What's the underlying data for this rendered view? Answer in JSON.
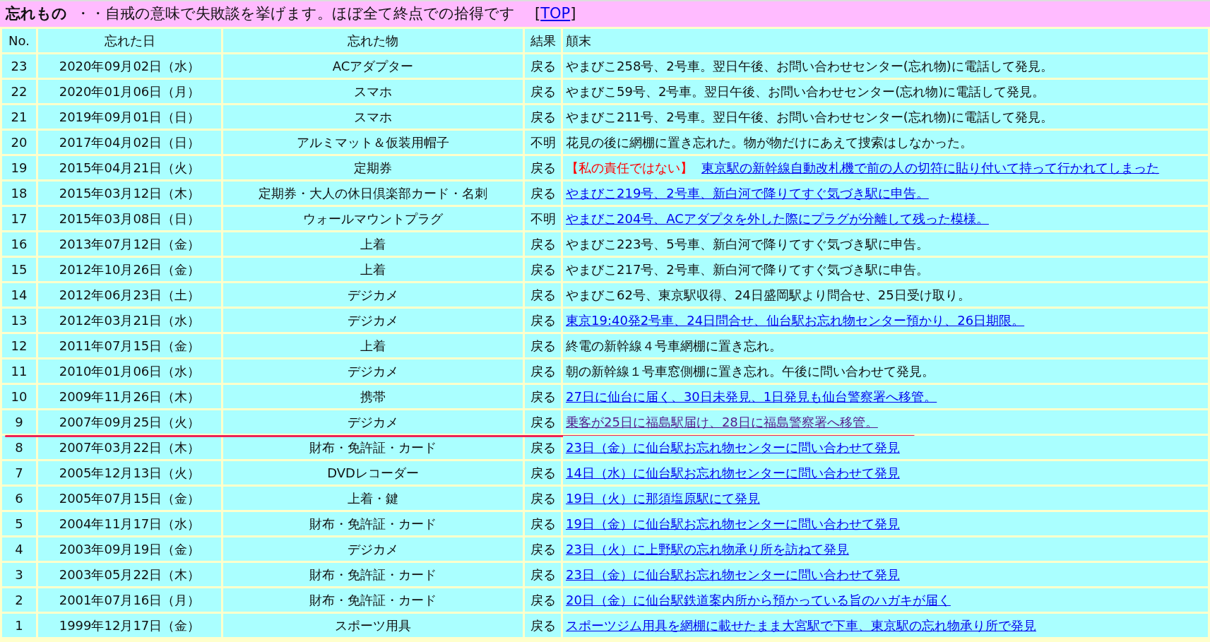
{
  "header": {
    "title": "忘れもの",
    "description": "・・自戒の意味で失敗談を挙げます。ほぼ全て終点での拾得です",
    "top_link": {
      "open": "[",
      "label": "TOP",
      "close": "]"
    }
  },
  "table": {
    "columns": [
      "No.",
      "忘れた日",
      "忘れた物",
      "結果",
      "顛末"
    ],
    "rows": [
      {
        "no": "23",
        "date": "2020年09月02日（水）",
        "item": "ACアダプター",
        "result": "戻る",
        "remarks": [
          {
            "kind": "text",
            "text": "やまびこ258号、2号車。翌日午後、お問い合わせセンター(忘れ物)に電話して発見。"
          }
        ]
      },
      {
        "no": "22",
        "date": "2020年01月06日（月）",
        "item": "スマホ",
        "result": "戻る",
        "remarks": [
          {
            "kind": "text",
            "text": "やまびこ59号、2号車。翌日午後、お問い合わせセンター(忘れ物)に電話して発見。"
          }
        ]
      },
      {
        "no": "21",
        "date": "2019年09月01日（日）",
        "item": "スマホ",
        "result": "戻る",
        "remarks": [
          {
            "kind": "text",
            "text": "やまびこ211号、2号車。翌日午後、お問い合わせセンター(忘れ物)に電話して発見。"
          }
        ]
      },
      {
        "no": "20",
        "date": "2017年04月02日（日）",
        "item": "アルミマット＆仮装用帽子",
        "result": "不明",
        "remarks": [
          {
            "kind": "text",
            "text": "花見の後に網棚に置き忘れた。物が物だけにあえて捜索はしなかった。"
          }
        ]
      },
      {
        "no": "19",
        "date": "2015年04月21日（火）",
        "item": "定期券",
        "result": "戻る",
        "remarks": [
          {
            "kind": "note",
            "text": "【私の責任ではない】"
          },
          {
            "kind": "link",
            "text": "東京駅の新幹線自動改札機で前の人の切符に貼り付いて持って行かれてしまった"
          }
        ]
      },
      {
        "no": "18",
        "date": "2015年03月12日（木）",
        "item": "定期券・大人の休日倶楽部カード・名刺",
        "result": "戻る",
        "remarks": [
          {
            "kind": "link",
            "text": "やまびこ219号、2号車、新白河で降りてすぐ気づき駅に申告。"
          }
        ]
      },
      {
        "no": "17",
        "date": "2015年03月08日（日）",
        "item": "ウォールマウントプラグ",
        "result": "不明",
        "remarks": [
          {
            "kind": "link",
            "text": "やまびこ204号、ACアダプタを外した際にプラグが分離して残った模様。"
          }
        ]
      },
      {
        "no": "16",
        "date": "2013年07月12日（金）",
        "item": "上着",
        "result": "戻る",
        "remarks": [
          {
            "kind": "text",
            "text": "やまびこ223号、5号車、新白河で降りてすぐ気づき駅に申告。"
          }
        ]
      },
      {
        "no": "15",
        "date": "2012年10月26日（金）",
        "item": "上着",
        "result": "戻る",
        "remarks": [
          {
            "kind": "text",
            "text": "やまびこ217号、2号車、新白河で降りてすぐ気づき駅に申告。"
          }
        ]
      },
      {
        "no": "14",
        "date": "2012年06月23日（土）",
        "item": "デジカメ",
        "result": "戻る",
        "remarks": [
          {
            "kind": "text",
            "text": "やまびこ62号、東京駅収得、24日盛岡駅より問合せ、25日受け取り。"
          }
        ]
      },
      {
        "no": "13",
        "date": "2012年03月21日（水）",
        "item": "デジカメ",
        "result": "戻る",
        "remarks": [
          {
            "kind": "link",
            "text": "東京19:40発2号車、24日問合せ、仙台駅お忘れ物センター預かり、26日期限。"
          }
        ]
      },
      {
        "no": "12",
        "date": "2011年07月15日（金）",
        "item": "上着",
        "result": "戻る",
        "remarks": [
          {
            "kind": "text",
            "text": "終電の新幹線４号車網棚に置き忘れ。"
          }
        ]
      },
      {
        "no": "11",
        "date": "2010年01月06日（水）",
        "item": "デジカメ",
        "result": "戻る",
        "remarks": [
          {
            "kind": "text",
            "text": "朝の新幹線１号車窓側棚に置き忘れ。午後に問い合わせて発見。"
          }
        ]
      },
      {
        "no": "10",
        "date": "2009年11月26日（木）",
        "item": "携帯",
        "result": "戻る",
        "remarks": [
          {
            "kind": "link",
            "text": "27日に仙台に届く、30日未発見、1日発見も仙台警察署へ移管。"
          }
        ]
      },
      {
        "no": "9",
        "date": "2007年09月25日（火）",
        "item": "デジカメ",
        "result": "戻る",
        "divider_below": true,
        "remarks": [
          {
            "kind": "visited_link",
            "text": "乗客が25日に福島駅届け、28日に福島警察署へ移管。"
          }
        ]
      },
      {
        "no": "8",
        "date": "2007年03月22日（木）",
        "item": "財布・免許証・カード",
        "result": "戻る",
        "remarks": [
          {
            "kind": "link",
            "text": "23日（金）に仙台駅お忘れ物センターに問い合わせて発見"
          }
        ]
      },
      {
        "no": "7",
        "date": "2005年12月13日（火）",
        "item": "DVDレコーダー",
        "result": "戻る",
        "remarks": [
          {
            "kind": "link",
            "text": "14日（水）に仙台駅お忘れ物センターに問い合わせて発見"
          }
        ]
      },
      {
        "no": "6",
        "date": "2005年07月15日（金）",
        "item": "上着・鍵",
        "result": "戻る",
        "remarks": [
          {
            "kind": "link",
            "text": "19日（火）に那須塩原駅にて発見"
          }
        ]
      },
      {
        "no": "5",
        "date": "2004年11月17日（水）",
        "item": "財布・免許証・カード",
        "result": "戻る",
        "remarks": [
          {
            "kind": "link",
            "text": "19日（金）に仙台駅お忘れ物センターに問い合わせて発見"
          }
        ]
      },
      {
        "no": "4",
        "date": "2003年09月19日（金）",
        "item": "デジカメ",
        "result": "戻る",
        "remarks": [
          {
            "kind": "link",
            "text": "23日（火）に上野駅の忘れ物承り所を訪ねて発見"
          }
        ]
      },
      {
        "no": "3",
        "date": "2003年05月22日（木）",
        "item": "財布・免許証・カード",
        "result": "戻る",
        "remarks": [
          {
            "kind": "link",
            "text": "23日（金）に仙台駅お忘れ物センターに問い合わせて発見"
          }
        ]
      },
      {
        "no": "2",
        "date": "2001年07月16日（月）",
        "item": "財布・免許証・カード",
        "result": "戻る",
        "remarks": [
          {
            "kind": "link",
            "text": "20日（金）に仙台駅鉄道案内所から預かっている旨のハガキが届く"
          }
        ]
      },
      {
        "no": "1",
        "date": "1999年12月17日（金）",
        "item": "スポーツ用具",
        "result": "戻る",
        "remarks": [
          {
            "kind": "link",
            "text": "スポーツジム用具を網棚に載せたまま大宮駅で下車、東京駅の忘れ物承り所で発見"
          }
        ]
      }
    ]
  }
}
